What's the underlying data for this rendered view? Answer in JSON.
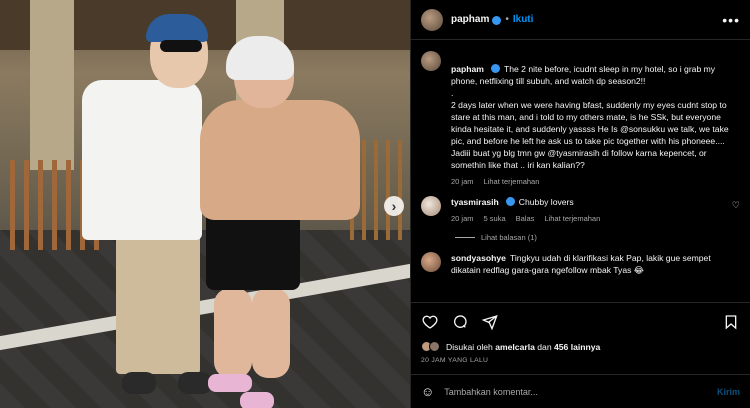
{
  "header": {
    "username": "papham",
    "follow_label": "Ikuti",
    "separator": "•",
    "more": "•••"
  },
  "caption": {
    "username": "papham",
    "text": "The 2 nite before, icudnt sleep in my hotel, so i grab my phone, netflixing till subuh, and watch dp season2!!\n.\n2 days later when we were having bfast, suddenly my eyes cudnt stop to stare at this man, and i told to my others mate, is he SSk, but everyone kinda hesitate it, and suddenly yassss He Is @sonsukku we talk, we take pic, and before he left he ask us to take pic together with his phoneee.... Jadiii buat yg blg tmn gw @tyasmirasih di follow karna kepencet, or somethin like that .. iri kan kalian??",
    "time": "20 jam",
    "translate": "Lihat terjemahan"
  },
  "comments": [
    {
      "username": "tyasmirasih",
      "text": "Chubby lovers",
      "time": "20 jam",
      "likes": "5 suka",
      "reply": "Balas",
      "translate": "Lihat terjemahan",
      "view_replies": "Lihat balasan (1)"
    },
    {
      "username": "sondyasohye",
      "text": "Tingkyu udah di klarifikasi kak Pap, lakik gue sempet dikatain redflag gara-gara ngefollow mbak Tyas 😂"
    }
  ],
  "icons": {
    "like": "heart-icon",
    "comment": "comment-icon",
    "share": "share-icon",
    "save": "bookmark-icon",
    "emoji": "emoji-icon",
    "next": "chevron-right-icon"
  },
  "likes": {
    "prefix": "Disukai oleh",
    "user": "amelcarla",
    "middle": "dan",
    "others": "456 lainnya"
  },
  "timestamp": "20 JAM YANG LALU",
  "comment_input": {
    "placeholder": "Tambahkan komentar...",
    "send_label": "Kirim"
  },
  "colors": {
    "accent": "#0095f6",
    "verified": "#3897f0",
    "muted": "#a8a8a8",
    "background": "#000000"
  }
}
